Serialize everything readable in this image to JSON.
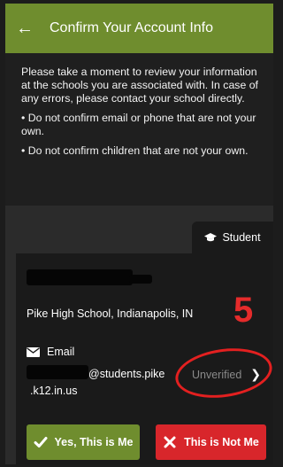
{
  "header": {
    "title": "Confirm Your Account Info",
    "back_icon": "arrow-left-icon"
  },
  "notice": {
    "intro": "Please take a moment to review your information at the schools you are associated with. In case of any errors, please contact your school directly.",
    "bullet1": "• Do not confirm email or phone that are not your own.",
    "bullet2": "• Do not confirm children that are not your own."
  },
  "tab": {
    "label": "Student",
    "icon": "graduation-cap-icon"
  },
  "card": {
    "school": "Pike High School, Indianapolis, IN",
    "annotation_number": "5",
    "email_label": "Email",
    "email_icon": "envelope-icon",
    "email_suffix": "@students.pike",
    "email_domain": ".k12.in.us",
    "email_status": "Unverified"
  },
  "actions": {
    "yes_label": "Yes, This is Me",
    "no_label": "This is Not Me"
  },
  "colors": {
    "accent_green": "#6f8d2e",
    "danger_red": "#d8262b",
    "annotation_red": "#e32020"
  }
}
